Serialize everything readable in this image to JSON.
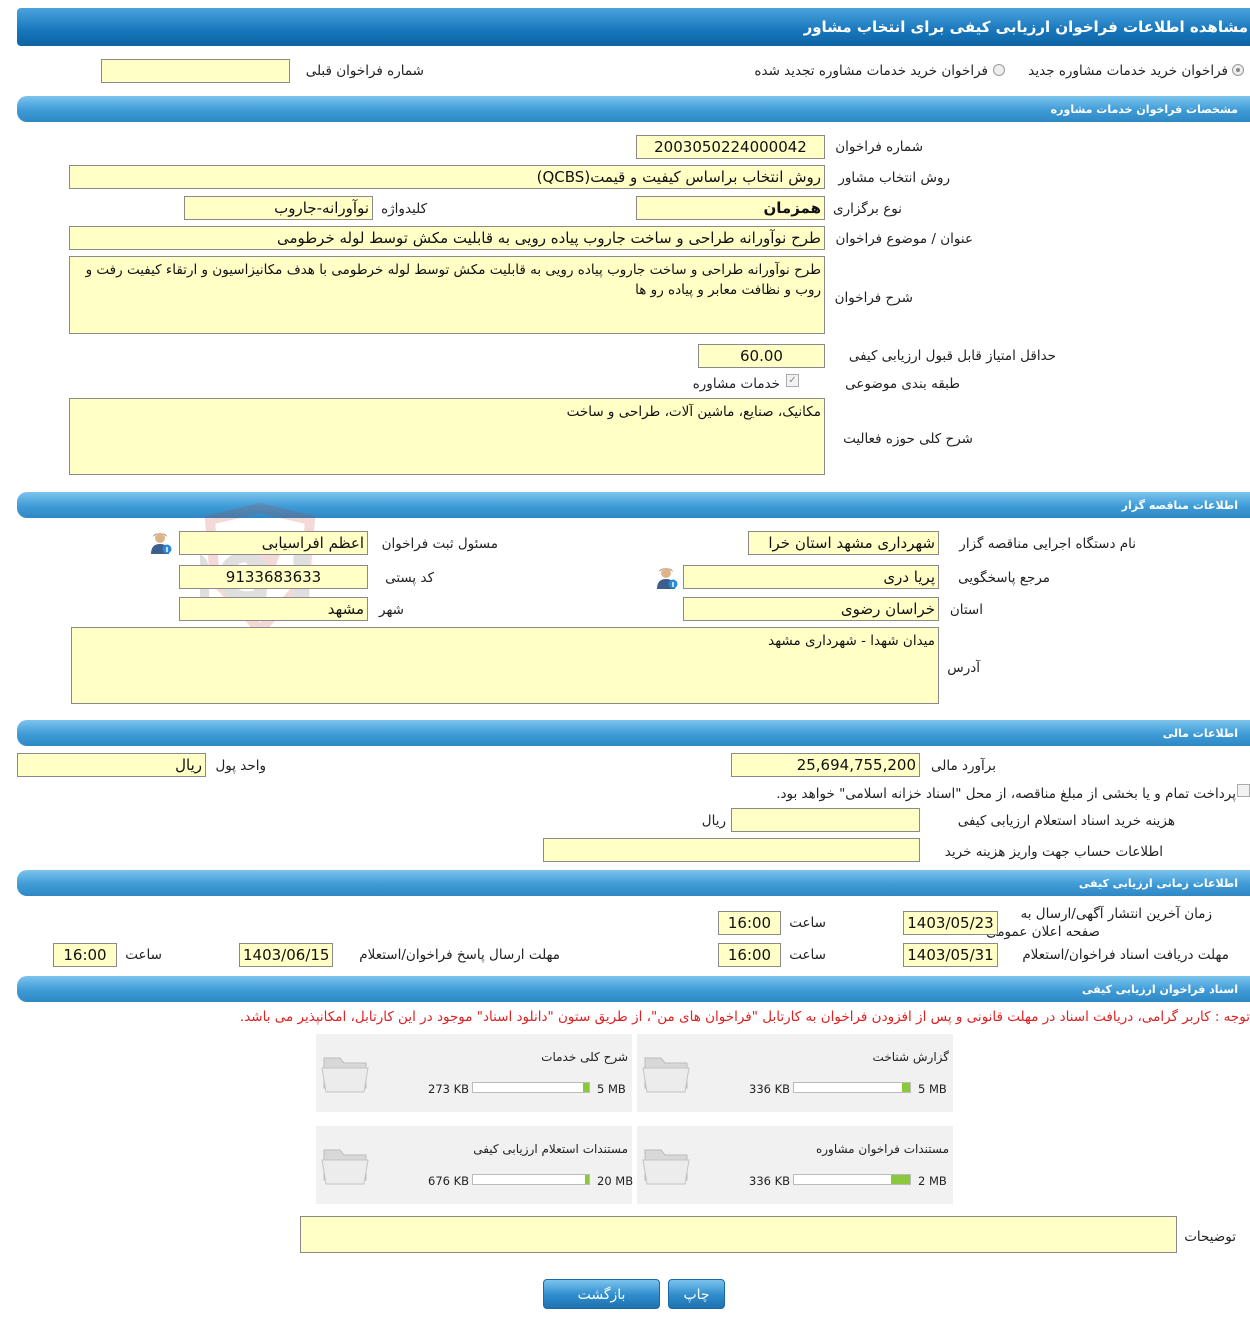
{
  "page_title": "مشاهده اطلاعات فراخوان ارزیابی کیفی برای انتخاب مشاور",
  "top_options": {
    "radio_new": "فراخوان خرید خدمات مشاوره جدید",
    "radio_renewed": "فراخوان خرید خدمات مشاوره تجدید شده",
    "prev_number_label": "شماره فراخوان قبلی",
    "prev_number_value": ""
  },
  "sections": {
    "consulting": "مشخصات فراخوان خدمات مشاوره",
    "tenderer": "اطلاعات مناقصه گزار",
    "financial": "اطلاعات مالی",
    "timing": "اطلاعات زمانی ارزیابی کیفی",
    "documents": "اسناد فراخوان ارزیابی کیفی"
  },
  "consulting": {
    "number_label": "شماره فراخوان",
    "number_value": "2003050224000042",
    "method_label": "روش انتخاب مشاور",
    "method_value": "روش انتخاب براساس کیفیت و قیمت(QCBS)",
    "type_label": "نوع برگزاری",
    "type_value": "همزمان",
    "keyword_label": "کلیدواژه",
    "keyword_value": "نوآورانه-جاروب",
    "subject_label": "عنوان / موضوع فراخوان",
    "subject_value": "طرح نوآورانه طراحی و ساخت جاروب پیاده رویی به قابلیت مکش توسط لوله خرطومی",
    "description_label": "شرح فراخوان",
    "description_value": "طرح نوآورانه طراحی و ساخت جاروب پیاده رویی به قابلیت مکش توسط لوله خرطومی با هدف مکانیزاسیون و ارتقاء کیفیت رفت و روب و نظافت معابر و پیاده رو ها",
    "min_score_label": "حداقل امتیاز قابل قبول ارزیابی کیفی",
    "min_score_value": "60.00",
    "category_label": "طبقه بندی موضوعی",
    "category_check_label": "خدمات مشاوره",
    "activity_label": "شرح کلی حوزه فعالیت",
    "activity_value": "مکانیک، صنایع، ماشین آلات، طراحی و ساخت"
  },
  "tenderer": {
    "org_label": "نام دستگاه اجرایی مناقصه گزار",
    "org_value": "شهرداری مشهد استان خرا",
    "registrar_label": "مسئول ثبت فراخوان",
    "registrar_value": "اعظم افراسیابی",
    "responder_label": "مرجع پاسخگویی",
    "responder_value": "پریا دری",
    "postal_label": "کد پستی",
    "postal_value": "9133683633",
    "province_label": "استان",
    "province_value": "خراسان رضوی",
    "city_label": "شهر",
    "city_value": "مشهد",
    "address_label": "آدرس",
    "address_value": "میدان شهدا - شهرداری مشهد"
  },
  "financial": {
    "estimate_label": "برآورد مالی",
    "estimate_value": "25,694,755,200",
    "currency_label": "واحد پول",
    "currency_value": "ریال",
    "treasury_text": "پرداخت تمام و یا بخشی از مبلغ مناقصه، از محل \"اسناد خزانه اسلامی\" خواهد بود.",
    "doc_cost_label": "هزینه خرید اسناد استعلام ارزیابی کیفی",
    "doc_cost_value": "",
    "doc_cost_unit": "ریال",
    "account_label": "اطلاعات حساب جهت واریز هزینه خرید",
    "account_value": ""
  },
  "timing": {
    "publish_label_line1": "زمان آخرین انتشار آگهی/ارسال به",
    "publish_label_line2": "صفحه اعلان عمومی",
    "publish_date": "1403/05/23",
    "time_label": "ساعت",
    "publish_time": "16:00",
    "receive_label": "مهلت دریافت اسناد فراخوان/استعلام",
    "receive_date": "1403/05/31",
    "receive_time": "16:00",
    "response_label": "مهلت ارسال پاسخ فراخوان/استعلام",
    "response_date": "1403/06/15",
    "response_time": "16:00"
  },
  "documents": {
    "notice": "توجه : کاربر گرامی، دریافت اسناد در مهلت قانونی و پس از افزودن فراخوان به کارتابل \"فراخوان های من\"، از طریق ستون \"دانلود اسناد\" موجود در این کارتابل، امکانپذیر می باشد.",
    "items": [
      {
        "title": "گزارش شناخت",
        "size": "336 KB",
        "max": "5 MB",
        "fill": 0.066
      },
      {
        "title": "شرح کلی خدمات",
        "size": "273 KB",
        "max": "5 MB",
        "fill": 0.053
      },
      {
        "title": "مستندات فراخوان مشاوره",
        "size": "336 KB",
        "max": "2 MB",
        "fill": 0.164
      },
      {
        "title": "مستندات استعلام ارزیابی کیفی",
        "size": "676 KB",
        "max": "20 MB",
        "fill": 0.033
      }
    ],
    "notes_label": "توضیحات",
    "notes_value": ""
  },
  "buttons": {
    "print": "چاپ",
    "back": "بازگشت"
  },
  "watermark": "AriaTender.neT"
}
